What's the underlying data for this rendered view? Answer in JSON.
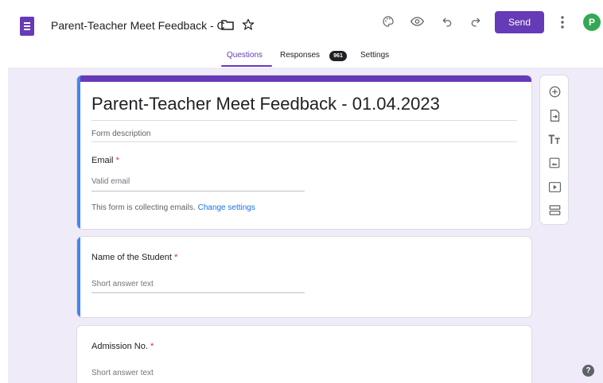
{
  "header": {
    "title": "Parent-Teacher Meet Feedback - C",
    "send_label": "Send",
    "avatar_initial": "P"
  },
  "tabs": {
    "questions": "Questions",
    "responses": "Responses",
    "responses_count": "961",
    "settings": "Settings"
  },
  "form": {
    "title": "Parent-Teacher Meet Feedback - 01.04.2023",
    "description_placeholder": "Form description",
    "email_label": "Email",
    "required_mark": "*",
    "email_placeholder": "Valid email",
    "collecting_note": "This form is collecting emails.",
    "change_settings": "Change settings",
    "questions": [
      {
        "label": "Name of the Student",
        "placeholder": "Short answer text"
      },
      {
        "label": "Admission No.",
        "placeholder": "Short answer text"
      }
    ]
  },
  "toolbar_icons": [
    "add-question-icon",
    "import-questions-icon",
    "add-title-icon",
    "add-image-icon",
    "add-video-icon",
    "add-section-icon"
  ],
  "colors": {
    "accent": "#673ab7",
    "active_question": "#4285f4",
    "required": "#d93025",
    "link": "#1a73e8",
    "background": "#f0ebf8",
    "avatar": "#34a853"
  }
}
